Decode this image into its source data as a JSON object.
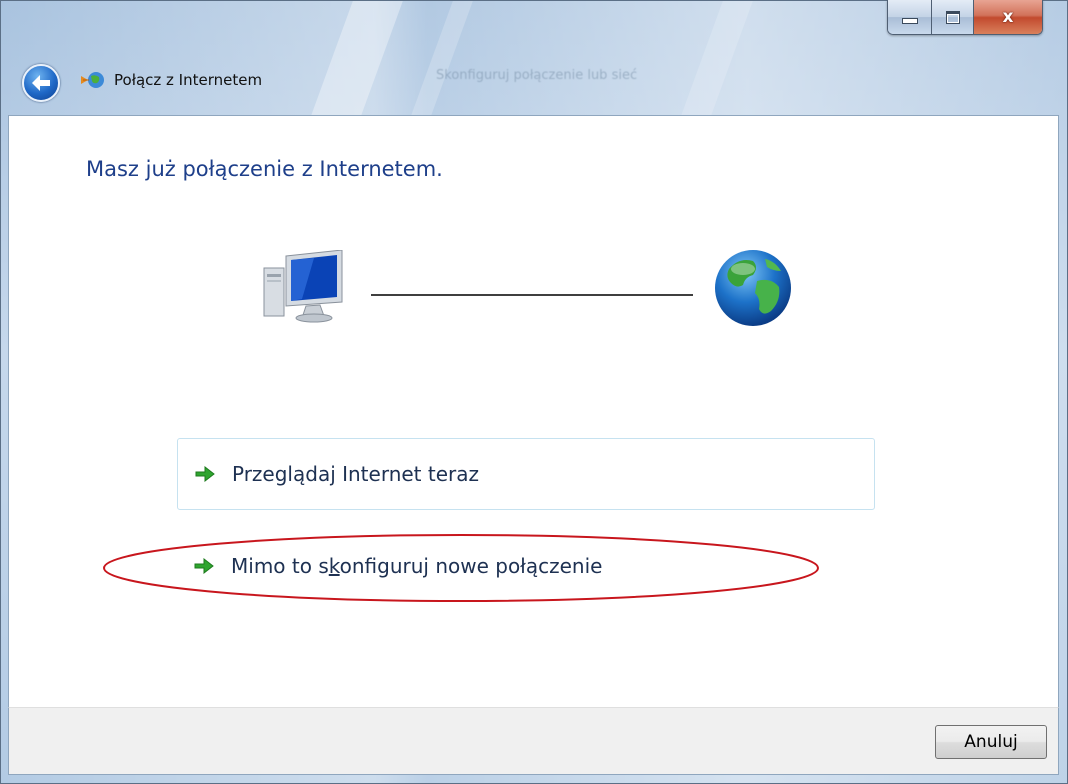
{
  "window": {
    "title": "Połącz z Internetem",
    "ghost_title": "Skonfiguruj połączenie lub sieć",
    "close_glyph": "x"
  },
  "main": {
    "heading": "Masz już połączenie z Internetem.",
    "options": [
      {
        "label": "Przeglądaj Internet teraz",
        "icon": "green-arrow-icon"
      },
      {
        "label_before": "Mimo to s",
        "label_access_key": "k",
        "label_after": "onfiguruj nowe połączenie",
        "icon": "green-arrow-icon"
      }
    ]
  },
  "footer": {
    "cancel_label": "Anuluj"
  },
  "colors": {
    "heading": "#1e3f8a",
    "annotation_ellipse": "#c8161d",
    "arrow": "#2fa52f"
  },
  "icons": [
    "back-arrow-icon",
    "network-icon",
    "computer-icon",
    "globe-icon",
    "minimize-icon",
    "maximize-icon",
    "close-icon"
  ]
}
